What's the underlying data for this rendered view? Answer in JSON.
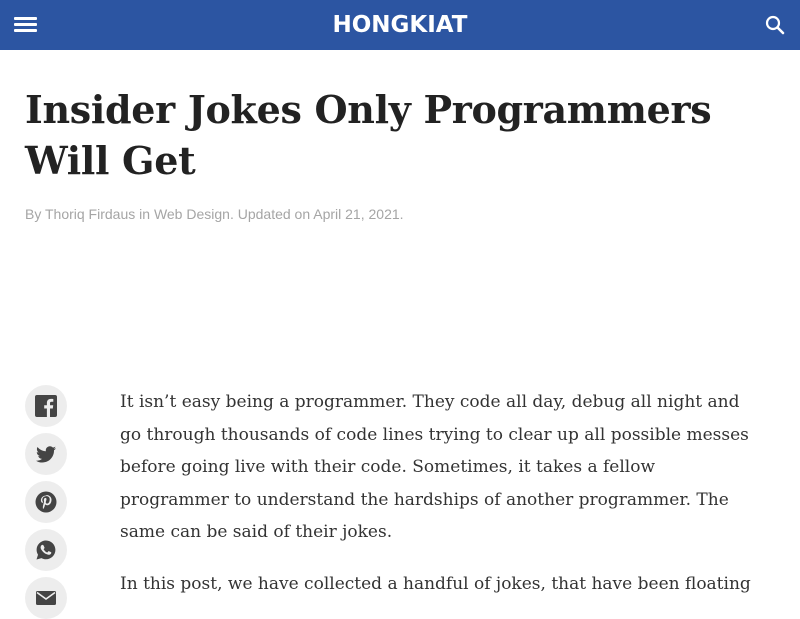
{
  "header": {
    "logo": "HONGKIAT",
    "menu_icon": "hamburger-menu-icon",
    "search_icon": "search-icon",
    "background_color": "#2c55a2"
  },
  "article": {
    "title": "Insider Jokes Only Programmers Will Get",
    "byline": {
      "prefix": "By ",
      "author": "Thoriq Firdaus",
      "in": " in ",
      "category": "Web Design",
      "updated": ". Updated on April 21, 2021."
    },
    "paragraphs": [
      "It isn’t easy being a programmer. They code all day, debug all night and go through thousands of code lines trying to clear up all possible messes before going live with their code. Sometimes, it takes a fellow programmer to understand the hardships of another programmer. The same can be said of their jokes.",
      "In this post, we have collected a handful of jokes, that have been floating"
    ]
  },
  "share": {
    "icons": [
      "facebook-icon",
      "twitter-icon",
      "pinterest-icon",
      "whatsapp-icon",
      "email-icon"
    ]
  }
}
